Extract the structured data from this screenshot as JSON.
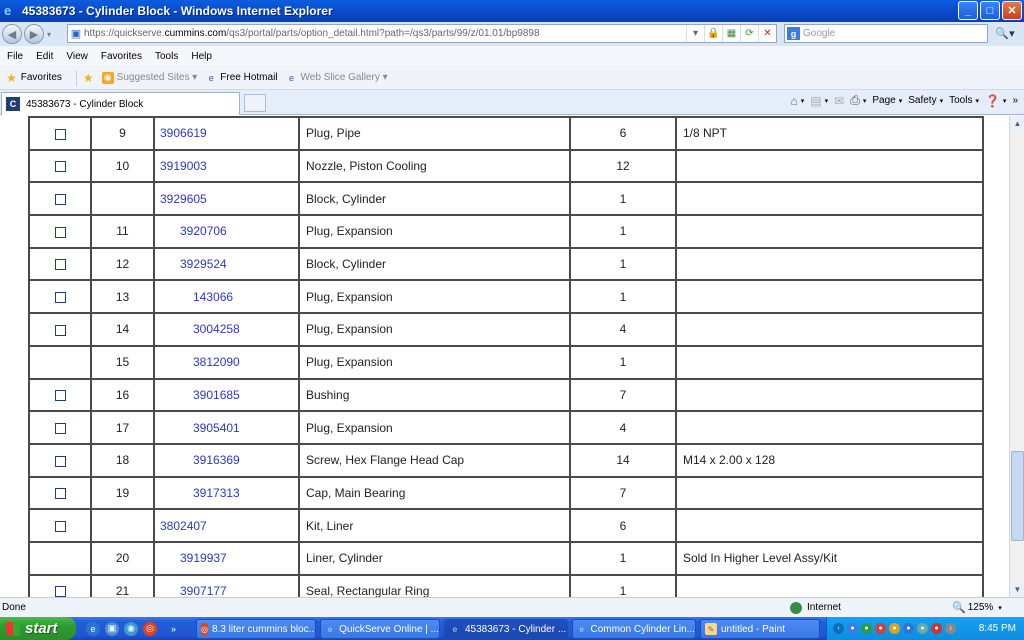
{
  "window": {
    "title": "45383673 - Cylinder Block - Windows Internet Explorer",
    "minimize": "_",
    "maximize": "□",
    "close": "✕"
  },
  "address": {
    "url_prefix": "https://quickserve.",
    "url_domain": "cummins.com",
    "url_rest": "/qs3/portal/parts/option_detail.html?path=/qs3/parts/99/z/01.01/bp9898",
    "search_placeholder": "Google"
  },
  "menu": [
    "File",
    "Edit",
    "View",
    "Favorites",
    "Tools",
    "Help"
  ],
  "favorites": {
    "label": "Favorites",
    "items": [
      {
        "label": "Suggested Sites ▾",
        "muted": true
      },
      {
        "label": "Free Hotmail",
        "muted": false
      },
      {
        "label": "Web Slice Gallery ▾",
        "muted": true
      }
    ]
  },
  "tab": {
    "label": "45383673 - Cylinder Block"
  },
  "commandbar": {
    "page": "Page",
    "safety": "Safety",
    "tools": "Tools"
  },
  "table": {
    "rows": [
      {
        "checkbox": true,
        "num": "9",
        "part": "3906619",
        "indent": 0,
        "desc": "Plug, Pipe",
        "qty": "6",
        "note": "1/8 NPT"
      },
      {
        "checkbox": true,
        "num": "10",
        "part": "3919003",
        "indent": 0,
        "desc": "Nozzle, Piston Cooling",
        "qty": "12",
        "note": ""
      },
      {
        "checkbox": true,
        "num": "",
        "part": "3929605",
        "indent": 0,
        "desc": "Block, Cylinder",
        "qty": "1",
        "note": ""
      },
      {
        "checkbox": true,
        "num": "11",
        "part": "3920706",
        "indent": 1,
        "desc": "Plug, Expansion",
        "qty": "1",
        "note": ""
      },
      {
        "checkbox": true,
        "num": "12",
        "part": "3929524",
        "indent": 1,
        "desc": "Block, Cylinder",
        "qty": "1",
        "note": ""
      },
      {
        "checkbox": true,
        "num": "13",
        "part": "143066",
        "indent": 2,
        "desc": "Plug, Expansion",
        "qty": "1",
        "note": ""
      },
      {
        "checkbox": true,
        "num": "14",
        "part": "3004258",
        "indent": 2,
        "desc": "Plug, Expansion",
        "qty": "4",
        "note": ""
      },
      {
        "checkbox": false,
        "num": "15",
        "part": "3812090",
        "indent": 2,
        "desc": "Plug, Expansion",
        "qty": "1",
        "note": ""
      },
      {
        "checkbox": true,
        "num": "16",
        "part": "3901685",
        "indent": 2,
        "desc": "Bushing",
        "qty": "7",
        "note": ""
      },
      {
        "checkbox": true,
        "num": "17",
        "part": "3905401",
        "indent": 2,
        "desc": "Plug, Expansion",
        "qty": "4",
        "note": ""
      },
      {
        "checkbox": true,
        "num": "18",
        "part": "3916369",
        "indent": 2,
        "desc": "Screw, Hex Flange Head Cap",
        "qty": "14",
        "note": "M14 x 2.00 x 128"
      },
      {
        "checkbox": true,
        "num": "19",
        "part": "3917313",
        "indent": 2,
        "desc": "Cap, Main Bearing",
        "qty": "7",
        "note": ""
      },
      {
        "checkbox": true,
        "num": "",
        "part": "3802407",
        "indent": 0,
        "desc": "Kit, Liner",
        "qty": "6",
        "note": ""
      },
      {
        "checkbox": false,
        "num": "20",
        "part": "3919937",
        "indent": 1,
        "desc": "Liner, Cylinder",
        "qty": "1",
        "note": "Sold In Higher Level Assy/Kit"
      },
      {
        "checkbox": true,
        "num": "21",
        "part": "3907177",
        "indent": 1,
        "desc": "Seal, Rectangular Ring",
        "qty": "1",
        "note": ""
      }
    ]
  },
  "status": {
    "text": "Done",
    "zone": "Internet",
    "zoom": "125%"
  },
  "taskbar": {
    "start": "start",
    "tasks": [
      {
        "label": "8.3 liter cummins bloc...",
        "active": false
      },
      {
        "label": "QuickServe Online | ...",
        "active": false
      },
      {
        "label": "45383673 - Cylinder ...",
        "active": true
      },
      {
        "label": "Common Cylinder Lin...",
        "active": false
      },
      {
        "label": "untitled - Paint",
        "active": false
      }
    ],
    "clock": "8:45 PM"
  },
  "colors": {
    "link": "#2a38c9",
    "titlebar": "#0a46c8",
    "taskbar": "#245edb",
    "start": "#2f9a2f"
  }
}
